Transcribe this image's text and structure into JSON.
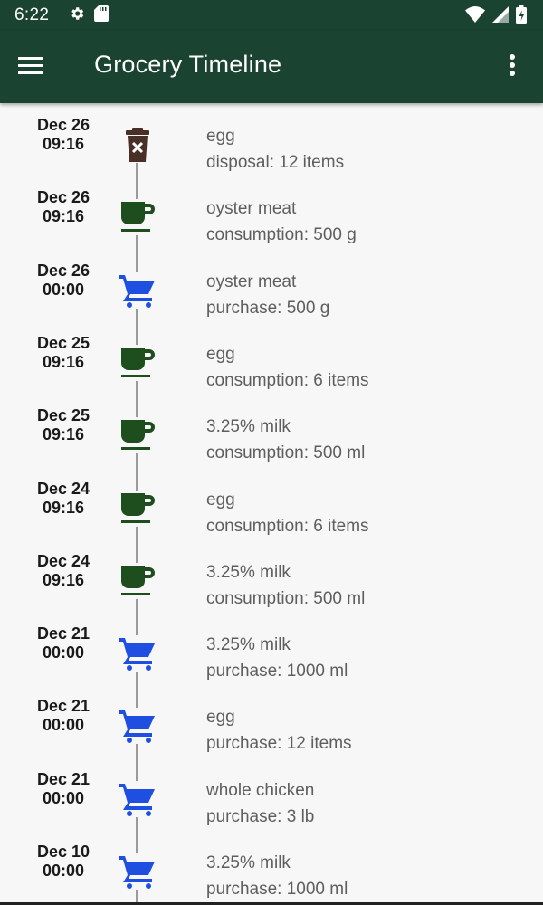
{
  "status_bar": {
    "time": "6:22",
    "icons_left": [
      "gear-icon",
      "sd-card-icon"
    ],
    "icons_right": [
      "wifi-icon",
      "signal-icon",
      "battery-icon"
    ]
  },
  "app_bar": {
    "title": "Grocery Timeline",
    "menu_icon": "hamburger-menu-icon",
    "overflow_icon": "more-vert-icon",
    "color": "#1b4332"
  },
  "colors": {
    "disposal": "#4a2f28",
    "consumption": "#1e4d1e",
    "purchase": "#1f4fe0"
  },
  "entries": [
    {
      "date": "Dec 26",
      "time": "09:16",
      "type": "disposal",
      "icon": "trash-icon",
      "name": "egg",
      "detail": "disposal: 12 items"
    },
    {
      "date": "Dec 26",
      "time": "09:16",
      "type": "consumption",
      "icon": "cup-icon",
      "name": "oyster meat",
      "detail": "consumption: 500 g"
    },
    {
      "date": "Dec 26",
      "time": "00:00",
      "type": "purchase",
      "icon": "cart-icon",
      "name": "oyster meat",
      "detail": "purchase: 500 g"
    },
    {
      "date": "Dec 25",
      "time": "09:16",
      "type": "consumption",
      "icon": "cup-icon",
      "name": "egg",
      "detail": "consumption: 6 items"
    },
    {
      "date": "Dec 25",
      "time": "09:16",
      "type": "consumption",
      "icon": "cup-icon",
      "name": "3.25% milk",
      "detail": "consumption: 500 ml"
    },
    {
      "date": "Dec 24",
      "time": "09:16",
      "type": "consumption",
      "icon": "cup-icon",
      "name": "egg",
      "detail": "consumption: 6 items"
    },
    {
      "date": "Dec 24",
      "time": "09:16",
      "type": "consumption",
      "icon": "cup-icon",
      "name": "3.25% milk",
      "detail": "consumption: 500 ml"
    },
    {
      "date": "Dec 21",
      "time": "00:00",
      "type": "purchase",
      "icon": "cart-icon",
      "name": "3.25% milk",
      "detail": "purchase: 1000 ml"
    },
    {
      "date": "Dec 21",
      "time": "00:00",
      "type": "purchase",
      "icon": "cart-icon",
      "name": "egg",
      "detail": "purchase: 12 items"
    },
    {
      "date": "Dec 21",
      "time": "00:00",
      "type": "purchase",
      "icon": "cart-icon",
      "name": "whole chicken",
      "detail": "purchase: 3 lb"
    },
    {
      "date": "Dec 10",
      "time": "00:00",
      "type": "purchase",
      "icon": "cart-icon",
      "name": "3.25% milk",
      "detail": "purchase: 1000 ml"
    }
  ]
}
